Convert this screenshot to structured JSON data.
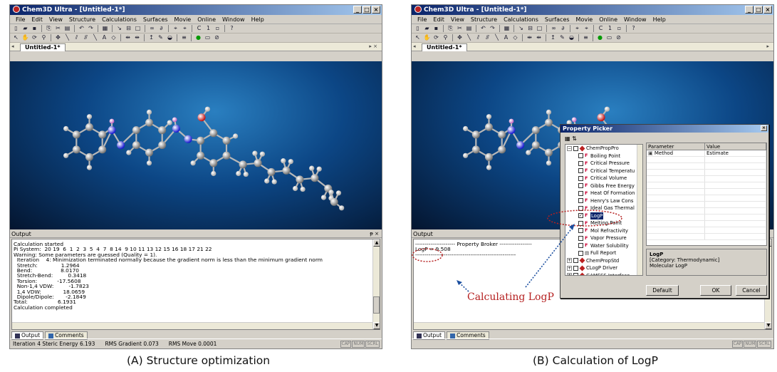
{
  "panel_a": {
    "title": "Chem3D Ultra - [Untitled-1*]",
    "menu": [
      "File",
      "Edit",
      "View",
      "Structure",
      "Calculations",
      "Surfaces",
      "Movie",
      "Online",
      "Window",
      "Help"
    ],
    "doc_tab": "Untitled-1*",
    "output_header": "Output",
    "output_text": "Calculation started\nPi System:  20 19  6  1  2  3  5  4  7  8 14  9 10 11 13 12 15 16 18 17 21 22\nWarning: Some parameters are guessed (Quality = 1).\n  Iteration    4: Minimization terminated normally because the gradient norm is less than the minimum gradient norm\n  Stretch:              1.2964\n  Bend:                 8.0170\n  Stretch-Bend:         0.3418\n  Torsion:            -17.5608\n  Non-1,4 VDW:         -1.7823\n  1,4 VDW:             18.0659\n  Dipole/Dipole:       -2.1849\nTotal:                  6.1931\nCalculation completed",
    "tabs": [
      "Output",
      "Comments"
    ],
    "status": [
      "Iteration   4  Steric Energy 6.193",
      "RMS Gradient 0.073",
      "RMS Move 0.0001"
    ],
    "indicators": [
      "CAP",
      "NUM",
      "SCRL"
    ]
  },
  "panel_b": {
    "title": "Chem3D Ultra - [Untitled-1*]",
    "menu": [
      "File",
      "Edit",
      "View",
      "Structure",
      "Calculations",
      "Surfaces",
      "Movie",
      "Online",
      "Window",
      "Help"
    ],
    "doc_tab": "Untitled-1*",
    "output_header": "Output",
    "output_text": "--------------------- Property Broker -----------------\nLogP = 9.508\n-----------------------------------------------------",
    "tabs": [
      "Output",
      "Comments"
    ],
    "indicators": [
      "CAP",
      "NUM",
      "SCRL"
    ],
    "picker": {
      "title": "Property Picker",
      "tree": [
        {
          "label": "ChemPropPro",
          "level": 0,
          "kind": "group",
          "expanded": true
        },
        {
          "label": "Boiling Point",
          "level": 1,
          "kind": "prop"
        },
        {
          "label": "Critical Pressure",
          "level": 1,
          "kind": "prop"
        },
        {
          "label": "Critical Temperatu",
          "level": 1,
          "kind": "prop"
        },
        {
          "label": "Critical Volume",
          "level": 1,
          "kind": "prop"
        },
        {
          "label": "Gibbs Free Energy",
          "level": 1,
          "kind": "prop"
        },
        {
          "label": "Heat Of Formation",
          "level": 1,
          "kind": "prop"
        },
        {
          "label": "Henry's Law Cons",
          "level": 1,
          "kind": "prop"
        },
        {
          "label": "Ideal Gas Thermal",
          "level": 1,
          "kind": "prop"
        },
        {
          "label": "LogP",
          "level": 1,
          "kind": "prop",
          "checked": true,
          "selected": true
        },
        {
          "label": "Melting Point",
          "level": 1,
          "kind": "prop"
        },
        {
          "label": "Mol Refractivity",
          "level": 1,
          "kind": "prop"
        },
        {
          "label": "Vapor Pressure",
          "level": 1,
          "kind": "prop"
        },
        {
          "label": "Water Solubility",
          "level": 1,
          "kind": "prop"
        },
        {
          "label": "Full Report",
          "level": 1,
          "kind": "report"
        },
        {
          "label": "ChemPropStd",
          "level": 0,
          "kind": "group"
        },
        {
          "label": "CLogP Driver",
          "level": 0,
          "kind": "group"
        },
        {
          "label": "GAMESS Interface",
          "level": 0,
          "kind": "group"
        }
      ],
      "table_headers": [
        "Parameter",
        "Value"
      ],
      "table_rows": [
        [
          "Method",
          "Estimate"
        ]
      ],
      "desc_title": "LogP",
      "desc_category": "[Category: Thermodynamic]",
      "desc_text": "Molecular LogP",
      "buttons": {
        "default": "Default",
        "ok": "OK",
        "cancel": "Cancel"
      }
    },
    "annotation": "Calculating LogP"
  },
  "captions": [
    "(A) Structure optimization",
    "(B) Calculation of LogP"
  ],
  "colors": {
    "title_bar": "#0a246a",
    "viewport": "#0c4685",
    "annotation": "#b52020",
    "carbon": "#c8c8c8",
    "nitrogen": "#2a2aff",
    "oxygen": "#e02020",
    "hydrogen": "#ffffff"
  }
}
